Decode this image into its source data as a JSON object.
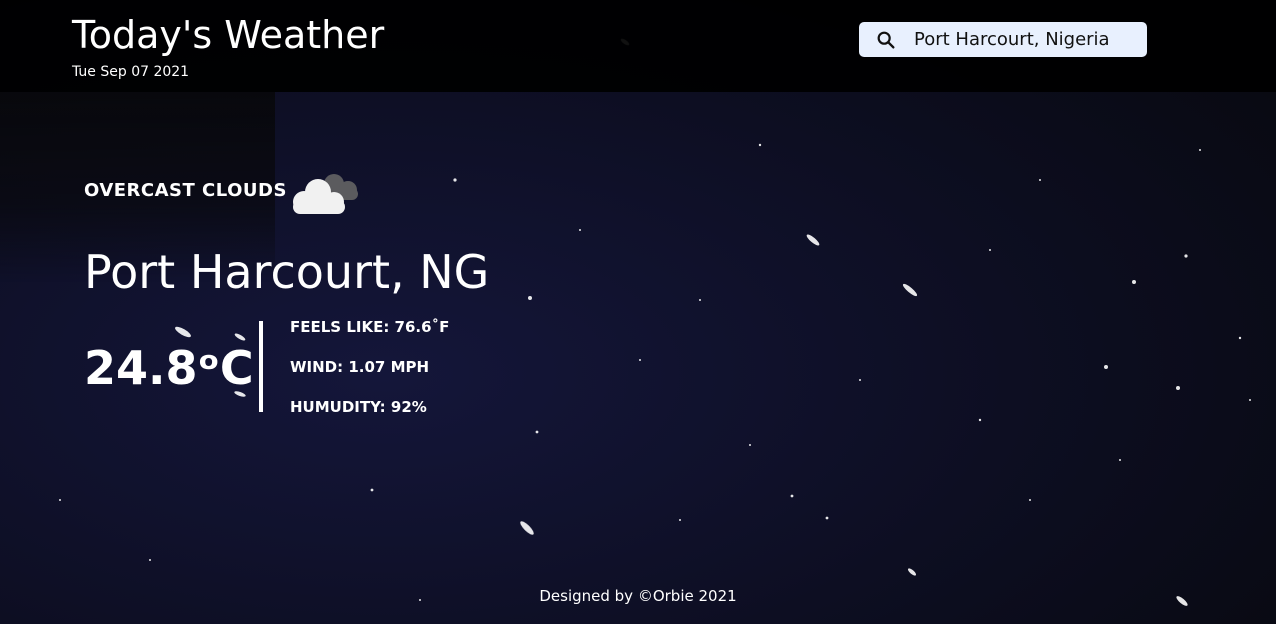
{
  "header": {
    "title": "Today's Weather",
    "date": "Tue Sep 07 2021"
  },
  "search": {
    "value": "Port Harcourt, Nigeria",
    "icon": "search-icon"
  },
  "weather": {
    "condition": "OVERCAST CLOUDS",
    "condition_icon": "overcast-clouds-icon",
    "city": "Port Harcourt, NG",
    "temperature": "24.8ᵒC",
    "feels_like": "FEELS LIKE: 76.6˚F",
    "wind": "WIND: 1.07 MPH",
    "humidity": "HUMUDITY: 92%"
  },
  "footer": {
    "credit": "Designed by ©Orbie 2021"
  },
  "colors": {
    "background": "#0b0c1a",
    "header_bg": "#000000",
    "search_bg": "#e8f0fe",
    "text": "#ffffff"
  }
}
